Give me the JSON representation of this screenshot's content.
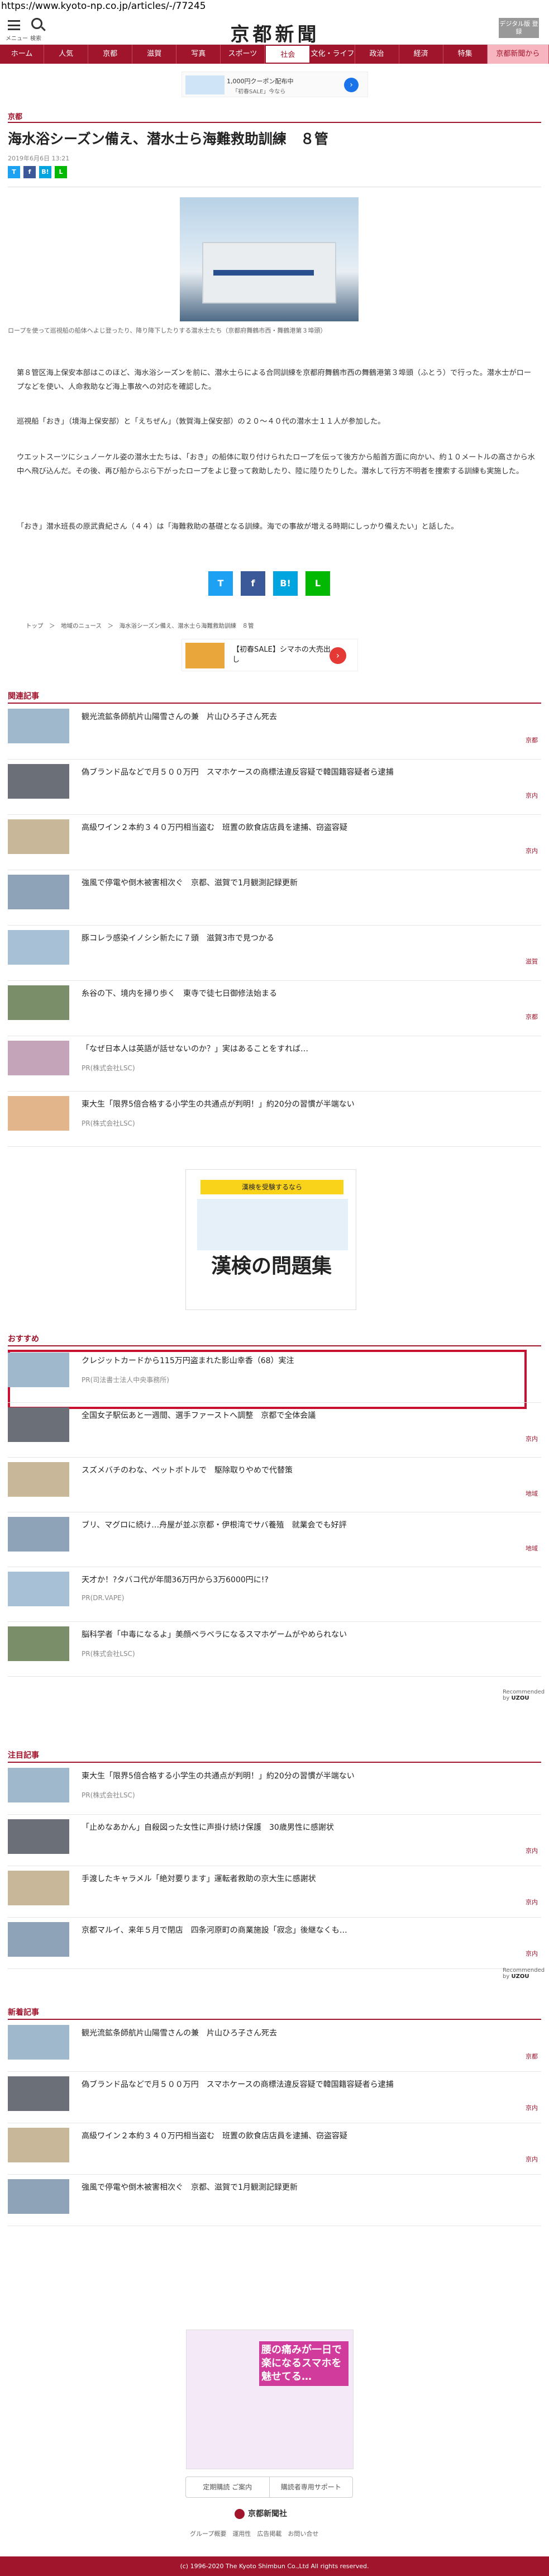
{
  "url": "https://www.kyoto-np.co.jp/articles/-/77245",
  "header": {
    "menu_label": "メニュー",
    "search_label": "検索",
    "logo": "京都新聞",
    "paper_button": "デジタル版 登録"
  },
  "nav": [
    "ホーム",
    "人気",
    "京都",
    "滋賀",
    "写真",
    "スポーツ",
    "社会",
    "文化・ライフ",
    "政治",
    "経済",
    "特集",
    "京都新聞から"
  ],
  "ad_top": {
    "title": "1,000円クーポン配布中",
    "body": "「初春SALE」今なら"
  },
  "section": "京都",
  "article": {
    "title": "海水浴シーズン備え、潜水士ら海難救助訓練　８管",
    "date": "2019年6月6日 13:21",
    "share": [
      "T",
      "f",
      "B!",
      "L"
    ],
    "caption": "ロープを使って巡視船の船体へよじ登ったり、降り降下したりする潜水士たち（京都府舞鶴市西・舞鶴港第３埠頭）",
    "paras": [
      "第８管区海上保安本部はこのほど、海水浴シーズンを前に、潜水士らによる合同訓練を京都府舞鶴市西の舞鶴港第３埠頭（ふとう）で行った。潜水士がロープなどを使い、人命救助など海上事故への対応を確認した。",
      "巡視船「おき」（境海上保安部）と「えちぜん」（敦賀海上保安部）の２０～４０代の潜水士１１人が参加した。",
      "ウエットスーツにシュノーケル姿の潜水士たちは、「おき」の船体に取り付けられたロープを伝って後方から船首方面に向かい、約１０メートルの高さから水中へ飛び込んだ。その後、再び船からぶら下がったロープをよじ登って救助したり、陸に陸りたりした。潜水して行方不明者を捜索する訓練も実施した。",
      "「おき」潜水班長の原武貴紀さん（４４）は「海難救助の基礎となる訓練。海での事故が増える時期にしっかり備えたい」と話した。"
    ]
  },
  "breadcrumb": "トップ　＞　地域のニュース　＞　海水浴シーズン備え、潜水士ら海難救助訓練　８管",
  "ad_mid": {
    "text": "【初春SALE】シマホの大売出し"
  },
  "related": {
    "heading": "関連記事",
    "items": [
      {
        "title": "観光流鉱条師航片山陽雪さんの兼　片山ひろ子さん死去",
        "tag": "京都"
      },
      {
        "title": "偽ブランド品などで月５００万円　スマホケースの商標法違反容疑で韓国籍容疑者ら逮捕",
        "tag": "京内"
      },
      {
        "title": "高級ワイン２本約３４０万円相当盗む　班置の飲食店店員を逮捕、窃盗容疑",
        "tag": "京内"
      },
      {
        "title": "強風で停電や倒木被害相次ぐ　京都、滋賀で1月観測記録更新",
        "tag": ""
      },
      {
        "title": "豚コレラ感染イノシシ新たに７頭　滋賀3市で見つかる",
        "tag": "滋賀"
      },
      {
        "title": "糸谷の下、境内を掃り歩く　東寺で徒七日御修法始まる",
        "tag": "京都"
      },
      {
        "title": "「なぜ日本人は英語が話せないのか？」実はあることをすれば…",
        "sub": "PR(株式会社LSC)",
        "tag": ""
      },
      {
        "title": "東大生「限界5倍合格する小学生の共通点が判明！」約20分の習慣が半端ない",
        "sub": "PR(株式会社LSC)",
        "tag": ""
      }
    ]
  },
  "big_ad": {
    "top": "漢検を受験するなら",
    "main": "漢検の問題集"
  },
  "recommend": {
    "heading": "おすすめ",
    "items": [
      {
        "title": "クレジットカードから115万円盗まれた影山幸香（68）実注",
        "sub": "PR(司法書士法人中央事務所)",
        "tag": ""
      },
      {
        "title": "全国女子駅伝あと一週間、選手ファーストへ調整　京都で全体会議",
        "tag": "京内"
      },
      {
        "title": "スズメバチのわな、ペットボトルで　駆除取りやめで代替策",
        "tag": "地域"
      },
      {
        "title": "ブリ、マグロに続け…舟屋が並ぶ京都・伊根湾でサバ養殖　就業会でも好評",
        "tag": "地域"
      },
      {
        "title": "天才か！?タバコ代が年間36万円から3万6000円に!?",
        "sub": "PR(DR.VAPE)",
        "tag": ""
      },
      {
        "title": "脳科学者「中毒になるよ」美顔ベラベラになるスマホゲームがやめられない",
        "sub": "PR(株式会社LSC)",
        "tag": ""
      }
    ],
    "credit": "Recommended by",
    "brand": "UZOU"
  },
  "attention": {
    "heading": "注目記事",
    "items": [
      {
        "title": "東大生「限界5倍合格する小学生の共通点が判明！」約20分の習慣が半端ない",
        "sub": "PR(株式会社LSC)",
        "tag": ""
      },
      {
        "title": "「止めなあかん」自殺図った女性に声掛け続け保護　30歳男性に感謝状",
        "tag": "京内"
      },
      {
        "title": "手渡したキャラメル「絶対要ります」運転者救助の京大生に感謝状",
        "tag": "京内"
      },
      {
        "title": "京都マルイ、来年５月で閉店　四条河原町の商業施設「寂念」後継なくも…",
        "tag": "京内"
      }
    ]
  },
  "new": {
    "heading": "新着記事",
    "items": [
      {
        "title": "観光流鉱条師航片山陽雪さんの兼　片山ひろ子さん死去",
        "tag": "京都"
      },
      {
        "title": "偽ブランド品などで月５００万円　スマホケースの商標法違反容疑で韓国籍容疑者ら逮捕",
        "tag": "京内"
      },
      {
        "title": "高級ワイン２本約３４０万円相当盗む　班置の飲食店店員を逮捕、窃盗容疑",
        "tag": "京内"
      },
      {
        "title": "強風で停電や倒木被害相次ぐ　京都、滋賀で1月観測記録更新",
        "tag": ""
      }
    ]
  },
  "bottom_ad": {
    "text": "腰の痛みが一日で楽になるスマホを魅せてる…"
  },
  "footer": {
    "btn1": "定期購読 ご案内",
    "btn2": "購読者専用サポート",
    "corp": "京都新聞社",
    "links": "グループ概要　運用性　広告掲載　お問い合せ",
    "copyright": "(c) 1996-2020 The Kyoto Shimbun Co.,Ltd All rights reserved."
  }
}
